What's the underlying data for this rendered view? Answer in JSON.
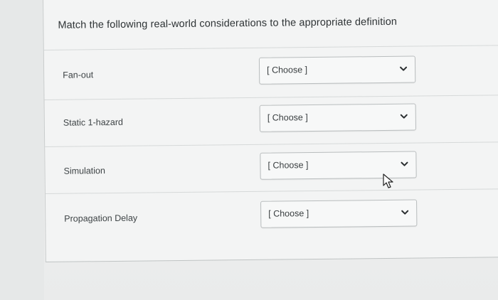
{
  "question": {
    "text": "Match the following real-world considerations to the appropriate definition"
  },
  "rows": [
    {
      "term": "Fan-out",
      "selected": "[ Choose ]"
    },
    {
      "term": "Static 1-hazard",
      "selected": "[ Choose ]"
    },
    {
      "term": "Simulation",
      "selected": "[ Choose ]"
    },
    {
      "term": "Propagation Delay",
      "selected": "[ Choose ]"
    }
  ],
  "icons": {
    "dropdown": "chevron-down-icon",
    "cursor": "mouse-pointer-icon"
  },
  "colors": {
    "background": "#eceeed",
    "card": "#f3f4f4",
    "text": "#2f3436",
    "border": "#b9bdbe"
  }
}
